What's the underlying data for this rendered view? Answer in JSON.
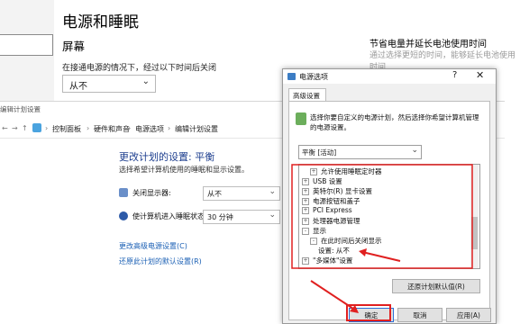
{
  "settings_window": {
    "title": "电源和睡眠",
    "section": "屏幕",
    "desc": "在接通电源的情况下，经过以下时间后关闭",
    "select_value": "从不",
    "right_title": "节省电量并延长电池使用时间",
    "right_desc": "通过选择更短的时间，能够延长电池使用时间"
  },
  "edit_plan_window": {
    "titlebar": "编辑计划设置",
    "breadcrumb": [
      "控制面板",
      "硬件和声音",
      "电源选项",
      "编辑计划设置"
    ],
    "heading": "更改计划的设置: 平衡",
    "desc": "选择希望计算机使用的睡眠和显示设置。",
    "rows": [
      {
        "label": "关闭显示器:",
        "value": "从不"
      },
      {
        "label": "使计算机进入睡眠状态:",
        "value": "30 分钟"
      }
    ],
    "links": [
      "更改高级电源设置(C)",
      "还原此计划的默认设置(R)"
    ]
  },
  "dialog": {
    "title": "电源选项",
    "help": "?",
    "close": "✕",
    "tab": "高级设置",
    "intro": "选择你要自定义的电源计划，然后选择你希望计算机管理的电源设置。",
    "plan_select": "平衡 [活动]",
    "tree": [
      {
        "indent": 1,
        "box": "+",
        "label": "允许使用睡眠定时器"
      },
      {
        "indent": 0,
        "box": "+",
        "label": "USB 设置"
      },
      {
        "indent": 0,
        "box": "+",
        "label": "英特尔(R) 显卡设置"
      },
      {
        "indent": 0,
        "box": "+",
        "label": "电源按钮和盖子"
      },
      {
        "indent": 0,
        "box": "+",
        "label": "PCI Express"
      },
      {
        "indent": 0,
        "box": "+",
        "label": "处理器电源管理"
      },
      {
        "indent": 0,
        "box": "-",
        "label": "显示"
      },
      {
        "indent": 1,
        "box": "-",
        "label": "在此时间后关闭显示"
      },
      {
        "indent": 2,
        "box": "",
        "label": "设置: 从不"
      },
      {
        "indent": 0,
        "box": "+",
        "label": "\"多媒体\"设置"
      }
    ],
    "restore_button": "还原计划默认值(R)",
    "buttons": {
      "ok": "确定",
      "cancel": "取消",
      "apply": "应用(A)"
    }
  },
  "colors": {
    "accent": "#1e3f8f",
    "link": "#1a5fb4",
    "highlight": "#e02020"
  }
}
